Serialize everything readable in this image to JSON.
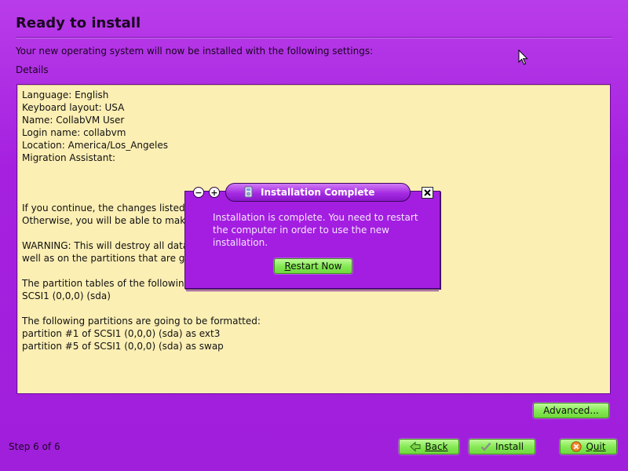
{
  "page": {
    "title": "Ready to install",
    "subtitle": "Your new operating system will now be installed with the following settings:",
    "details_label": "Details"
  },
  "details": {
    "lines": [
      "Language: English",
      "Keyboard layout: USA",
      "Name: CollabVM User",
      "Login name: collabvm",
      "Location: America/Los_Angeles",
      "Migration Assistant:",
      "",
      "",
      "",
      "If you continue, the changes listed",
      "Otherwise, you will be able to make",
      "",
      "WARNING: This will destroy all data",
      "well as on the partitions that are go",
      "",
      "The partition tables of the following",
      "SCSI1 (0,0,0) (sda)",
      "",
      "The following partitions are going to be formatted:",
      "partition #1 of SCSI1 (0,0,0) (sda) as ext3",
      "partition #5 of SCSI1 (0,0,0) (sda) as swap"
    ]
  },
  "buttons": {
    "advanced": "Advanced...",
    "back": "Back",
    "install": "Install",
    "quit": "Quit"
  },
  "footer": {
    "step": "Step 6 of 6"
  },
  "dialog": {
    "title": "Installation Complete",
    "message": "Installation is complete. You need to restart the computer in order to use the new installation.",
    "restart_button": "Restart Now",
    "minimize_symbol": "−",
    "maximize_symbol": "+"
  },
  "icons": {
    "back": "back-arrow-icon",
    "install": "checkmark-icon",
    "quit": "cancel-icon",
    "dialog": "installer-icon",
    "close": "close-icon",
    "cursor": "mouse-pointer-icon"
  },
  "colors": {
    "background": "#a521df",
    "details_bg": "#fcefb4",
    "button_green": "#86ea55",
    "dialog_bg": "#a31ee0"
  }
}
